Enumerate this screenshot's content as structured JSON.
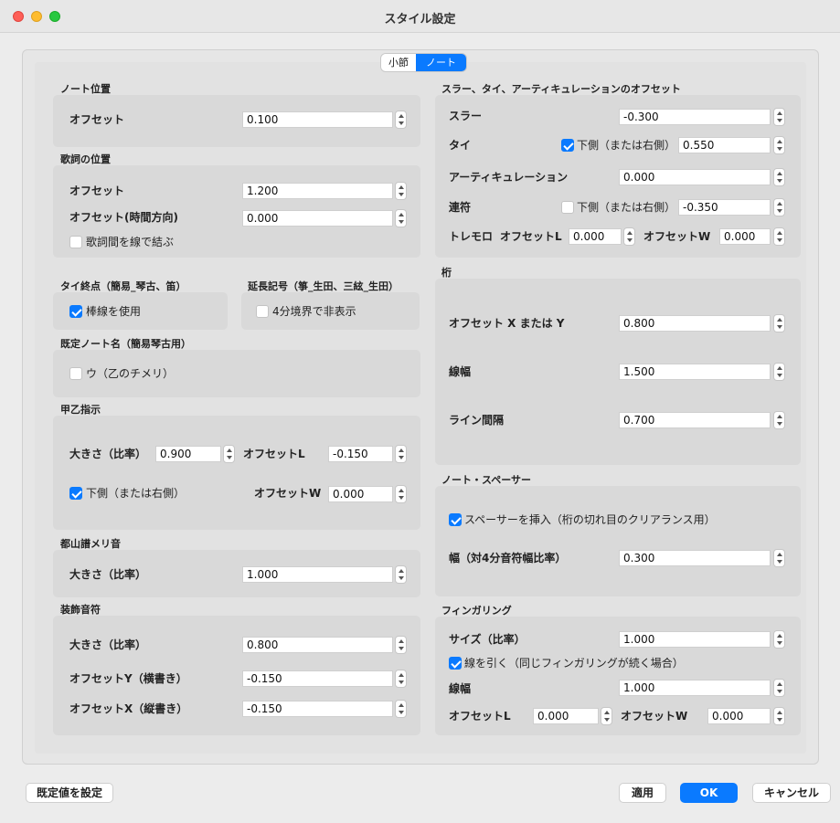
{
  "window": {
    "title": "スタイル設定"
  },
  "tabs": [
    {
      "label": "小節",
      "active": false
    },
    {
      "label": "ノート",
      "active": true
    }
  ],
  "note_position": {
    "title": "ノート位置",
    "offset_label": "オフセット",
    "offset_value": "0.100"
  },
  "lyrics_position": {
    "title": "歌詞の位置",
    "offset_label": "オフセット",
    "offset_value": "1.200",
    "time_offset_label": "オフセット(時間方向)",
    "time_offset_value": "0.000",
    "connect_label": "歌詞間を線で結ぶ",
    "connect_checked": false
  },
  "tie_end": {
    "title": "タイ終点（簡易_琴古、笛）",
    "use_bar_label": "棒線を使用",
    "use_bar_checked": true
  },
  "extension": {
    "title": "延長記号（箏_生田、三絃_生田）",
    "hide_label": "4分境界で非表示",
    "hide_checked": false
  },
  "default_note_name": {
    "title": "既定ノート名（簡易琴古用）",
    "u_label": "ウ（乙のチメリ）",
    "u_checked": false
  },
  "kouotsu": {
    "title": "甲乙指示",
    "size_label": "大きさ（比率）",
    "size_value": "0.900",
    "offset_l_label": "オフセットL",
    "offset_l_value": "-0.150",
    "below_label": "下側（または右側）",
    "below_checked": true,
    "offset_w_label": "オフセットW",
    "offset_w_value": "0.000"
  },
  "tozan_meri": {
    "title": "都山譜メリ音",
    "size_label": "大きさ（比率）",
    "size_value": "1.000"
  },
  "grace": {
    "title": "装飾音符",
    "size_label": "大きさ（比率）",
    "size_value": "0.800",
    "offset_y_label": "オフセットY（横書き）",
    "offset_y_value": "-0.150",
    "offset_x_label": "オフセットX（縦書き）",
    "offset_x_value": "-0.150"
  },
  "slur_offsets": {
    "title": "スラー、タイ、アーティキュレーションのオフセット",
    "slur_label": "スラー",
    "slur_value": "-0.300",
    "tie_label": "タイ",
    "tie_below_label": "下側（または右側）",
    "tie_below_checked": true,
    "tie_value": "0.550",
    "artic_label": "アーティキュレーション",
    "artic_value": "0.000",
    "tuplet_label": "連符",
    "tuplet_below_label": "下側（または右側）",
    "tuplet_below_checked": false,
    "tuplet_value": "-0.350",
    "tremolo_label": "トレモロ",
    "tremolo_offset_l_label": "オフセットL",
    "tremolo_offset_l_value": "0.000",
    "tremolo_offset_w_label": "オフセットW",
    "tremolo_offset_w_value": "0.000"
  },
  "beam": {
    "title": "桁",
    "offset_xy_label": "オフセット X または Y",
    "offset_xy_value": "0.800",
    "line_width_label": "線幅",
    "line_width_value": "1.500",
    "line_spacing_label": "ライン間隔",
    "line_spacing_value": "0.700"
  },
  "note_spacer": {
    "title": "ノート・スペーサー",
    "insert_label": "スペーサーを挿入（桁の切れ目のクリアランス用）",
    "insert_checked": true,
    "width_label": "幅（対4分音符幅比率）",
    "width_value": "0.300"
  },
  "fingering": {
    "title": "フィンガリング",
    "size_label": "サイズ（比率）",
    "size_value": "1.000",
    "draw_line_label": "線を引く（同じフィンガリングが続く場合）",
    "draw_line_checked": true,
    "line_width_label": "線幅",
    "line_width_value": "1.000",
    "offset_l_label": "オフセットL",
    "offset_l_value": "0.000",
    "offset_w_label": "オフセットW",
    "offset_w_value": "0.000"
  },
  "footer": {
    "default_label": "既定値を設定",
    "apply_label": "適用",
    "ok_label": "OK",
    "cancel_label": "キャンセル"
  }
}
